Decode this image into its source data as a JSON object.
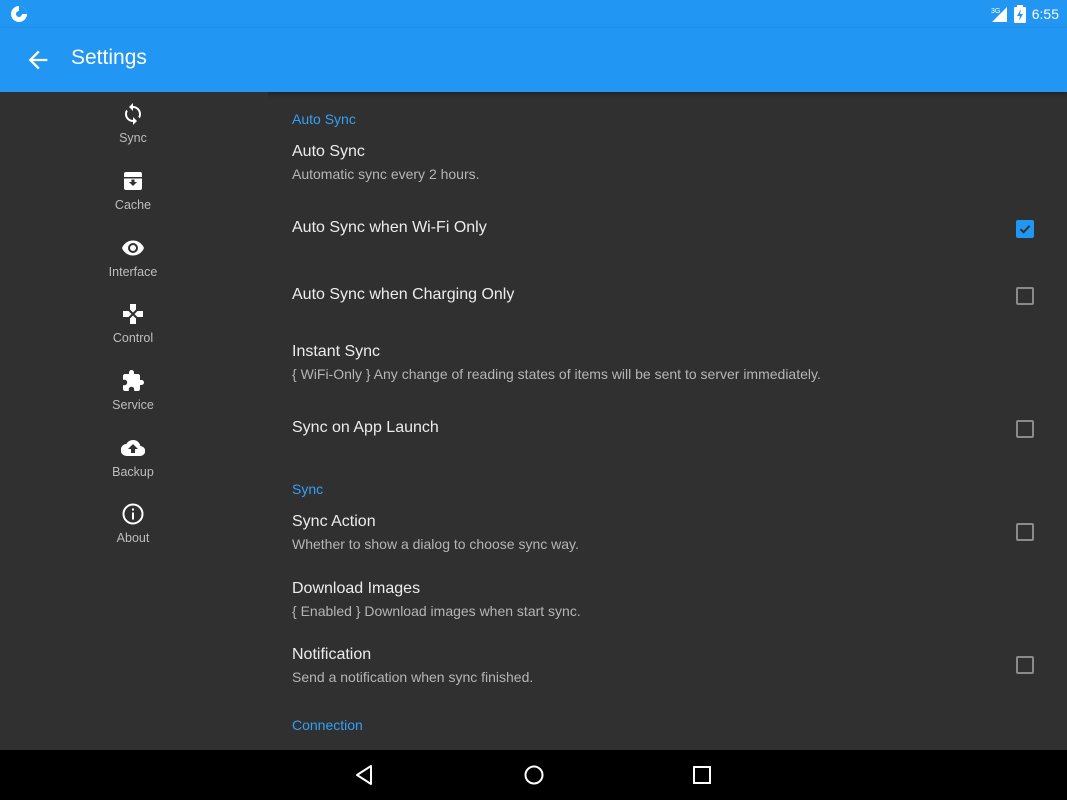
{
  "status_bar": {
    "time": "6:55",
    "network": "3G"
  },
  "app_bar": {
    "title": "Settings",
    "back_icon": "arrow-back-icon"
  },
  "sidebar": {
    "items": [
      {
        "label": "Sync",
        "icon": "sync-icon"
      },
      {
        "label": "Cache",
        "icon": "archive-icon"
      },
      {
        "label": "Interface",
        "icon": "eye-icon"
      },
      {
        "label": "Control",
        "icon": "gamepad-icon"
      },
      {
        "label": "Service",
        "icon": "puzzle-icon"
      },
      {
        "label": "Backup",
        "icon": "cloud-upload-icon"
      },
      {
        "label": "About",
        "icon": "info-icon"
      }
    ]
  },
  "sections": {
    "auto_sync": "Auto Sync",
    "sync": "Sync",
    "connection": "Connection"
  },
  "prefs": {
    "auto_sync": {
      "title": "Auto Sync",
      "summary": "Automatic sync every 2 hours."
    },
    "wifi_only": {
      "title": "Auto Sync when Wi-Fi Only",
      "checked": true
    },
    "charging_only": {
      "title": "Auto Sync when Charging Only",
      "checked": false
    },
    "instant_sync": {
      "title": "Instant Sync",
      "summary": "{ WiFi-Only } Any change of reading states of items will be sent to server immediately."
    },
    "app_launch": {
      "title": "Sync on App Launch",
      "checked": false
    },
    "sync_action": {
      "title": "Sync Action",
      "summary": "Whether to show a dialog to choose sync way.",
      "checked": false
    },
    "download_images": {
      "title": "Download Images",
      "summary": "{ Enabled } Download images when start sync."
    },
    "notification": {
      "title": "Notification",
      "summary": "Send a notification when sync finished.",
      "checked": false
    }
  },
  "colors": {
    "accent": "#2196f3",
    "section_header": "#33a0f5",
    "background": "#303030"
  }
}
